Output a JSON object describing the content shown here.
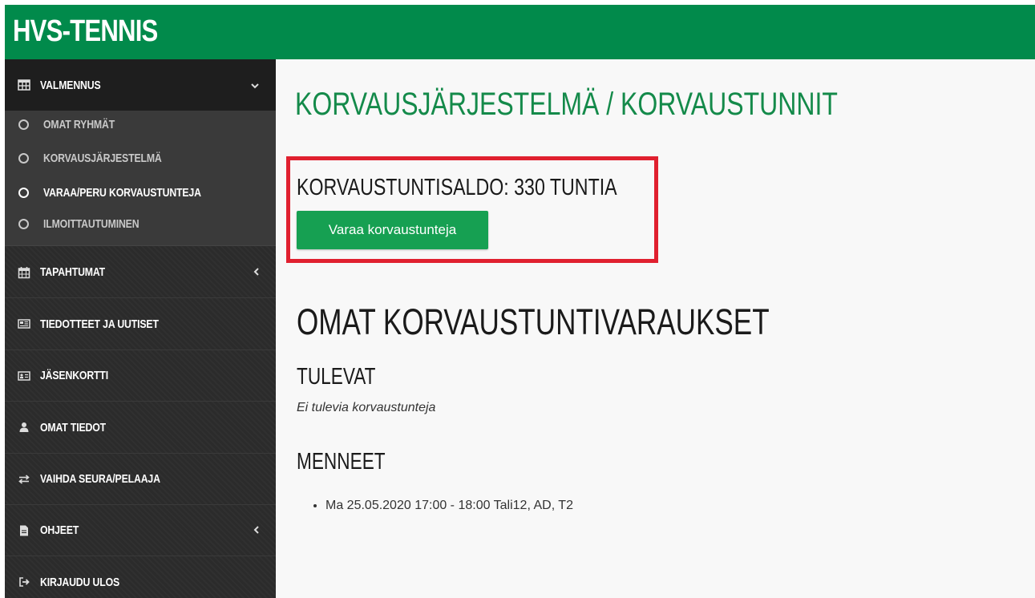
{
  "header": {
    "brand": "HVS-TENNIS",
    "bg_color": "#018a4b"
  },
  "sidebar": {
    "items": [
      {
        "label": "VALMENNUS",
        "icon": "table-icon",
        "caret": "⌄"
      },
      {
        "label": "TAPAHTUMAT",
        "icon": "calendar-icon",
        "caret": "‹"
      },
      {
        "label": "TIEDOTTEET JA UUTISET",
        "icon": "newspaper-icon",
        "caret": ""
      },
      {
        "label": "JÄSENKORTTI",
        "icon": "id-card-icon",
        "caret": ""
      },
      {
        "label": "OMAT TIEDOT",
        "icon": "user-icon",
        "caret": ""
      },
      {
        "label": "VAIHDA SEURA/PELAAJA",
        "icon": "exchange-icon",
        "caret": ""
      },
      {
        "label": "OHJEET",
        "icon": "file-icon",
        "caret": "‹"
      },
      {
        "label": "KIRJAUDU ULOS",
        "icon": "sign-out-icon",
        "caret": ""
      }
    ],
    "subitems": [
      {
        "label": "OMAT RYHMÄT"
      },
      {
        "label": "KORVAUSJÄRJESTELMÄ"
      },
      {
        "label": "VARAA/PERU KORVAUSTUNTEJA"
      },
      {
        "label": "ILMOITTAUTUMINEN"
      }
    ],
    "active_subitem": "VARAA/PERU KORVAUSTUNTEJA"
  },
  "main": {
    "title": "KORVAUSJÄRJESTELMÄ / KORVAUSTUNNIT",
    "balance_text": "KORVAUSTUNTISALDO: 330 TUNTIA",
    "book_button": "Varaa korvaustunteja",
    "section_title": "OMAT KORVAUSTUNTIVARAUKSET",
    "upcoming": {
      "heading": "TULEVAT",
      "empty_text": "Ei tulevia korvaustunteja"
    },
    "past": {
      "heading": "MENNEET",
      "items": [
        "Ma 25.05.2020 17:00 - 18:00 Tali12, AD, T2"
      ]
    }
  },
  "colors": {
    "title_green": "#148a4a",
    "button_green": "#16a052",
    "highlight_red": "#e0202f",
    "sidebar_bg": "#2b2b2b"
  }
}
